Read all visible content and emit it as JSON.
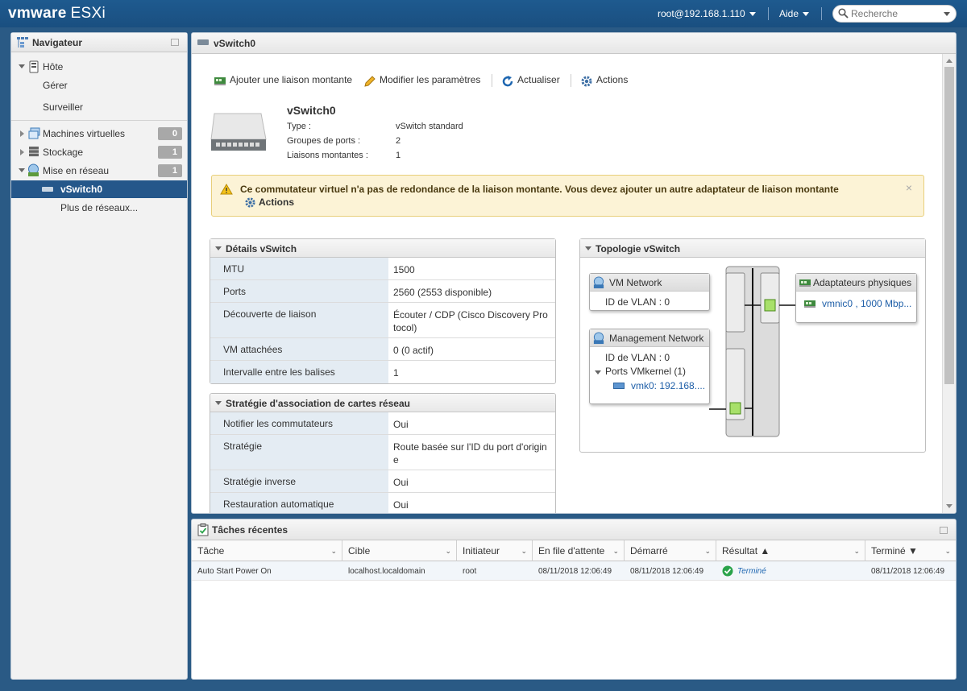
{
  "header": {
    "brand_vm": "vmware",
    "brand_esxi": "ESXi",
    "user": "root@192.168.1.110",
    "help": "Aide",
    "search_placeholder": "Recherche"
  },
  "navigator": {
    "title": "Navigateur",
    "host": "Hôte",
    "manage": "Gérer",
    "monitor": "Surveiller",
    "vms": "Machines virtuelles",
    "vms_count": "0",
    "storage": "Stockage",
    "storage_count": "1",
    "networking": "Mise en réseau",
    "networking_count": "1",
    "selected": "vSwitch0",
    "more": "Plus de réseaux..."
  },
  "main": {
    "title": "vSwitch0",
    "toolbar": {
      "add_uplink": "Ajouter une liaison montante",
      "edit_settings": "Modifier les paramètres",
      "refresh": "Actualiser",
      "actions": "Actions"
    },
    "summary": {
      "name": "vSwitch0",
      "type_label": "Type :",
      "type_value": "vSwitch standard",
      "portgroups_label": "Groupes de ports :",
      "portgroups_value": "2",
      "uplinks_label": "Liaisons montantes :",
      "uplinks_value": "1"
    },
    "alert": {
      "message": "Ce commutateur virtuel n'a pas de redondance de la liaison montante. Vous devez ajouter un autre adaptateur de liaison montante",
      "action": "Actions",
      "close": "×"
    },
    "details": {
      "title": "Détails vSwitch",
      "rows": [
        {
          "k": "MTU",
          "v": "1500"
        },
        {
          "k": "Ports",
          "v": "2560 (2553 disponible)"
        },
        {
          "k": "Découverte de liaison",
          "v": "Écouter / CDP (Cisco Discovery Protocol)"
        },
        {
          "k": "VM attachées",
          "v": "0 (0 actif)"
        },
        {
          "k": "Intervalle entre les balises",
          "v": "1"
        }
      ]
    },
    "teaming": {
      "title": "Stratégie d'association de cartes réseau",
      "rows": [
        {
          "k": "Notifier les commutateurs",
          "v": "Oui"
        },
        {
          "k": "Stratégie",
          "v": "Route basée sur l'ID du port d'origine"
        },
        {
          "k": "Stratégie inverse",
          "v": "Oui"
        },
        {
          "k": "Restauration automatique",
          "v": "Oui"
        }
      ]
    },
    "topology": {
      "title": "Topologie vSwitch",
      "vm_network": "VM Network",
      "vm_network_vlan": "ID de VLAN : 0",
      "mgmt_network": "Management Network",
      "mgmt_vlan": "ID de VLAN : 0",
      "vmkernel_ports": "Ports VMkernel (1)",
      "vmk0": "vmk0: 192.168....",
      "physical_adapters": "Adaptateurs physiques",
      "vmnic0": "vmnic0 , 1000 Mbp..."
    }
  },
  "tasks": {
    "title": "Tâches récentes",
    "columns": [
      "Tâche",
      "Cible",
      "Initiateur",
      "En file d'attente",
      "Démarré",
      "Résultat ▲",
      "Terminé ▼"
    ],
    "rows": [
      [
        "Auto Start Power On",
        "localhost.localdomain",
        "root",
        "08/11/2018 12:06:49",
        "08/11/2018 12:06:49",
        "Terminé",
        "08/11/2018 12:06:49"
      ]
    ]
  },
  "colors": {
    "topbar": "#1e5a8f",
    "selected": "#25578a",
    "alert_bg": "#fcf3d6",
    "key_bg": "#e4ecf3",
    "success": "#2aa34a"
  }
}
